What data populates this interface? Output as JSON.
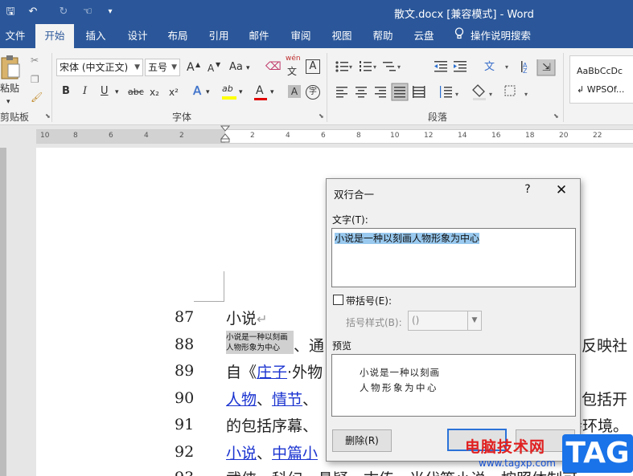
{
  "window": {
    "doc_title": "散文.docx [兼容模式]  -  Word"
  },
  "quick_access": {
    "save_glyph": "🖫",
    "undo_glyph": "↶",
    "redo_glyph": "↻",
    "touch_glyph": "☜",
    "customize_glyph": "▾"
  },
  "tabs": [
    {
      "label": "文件"
    },
    {
      "label": "开始"
    },
    {
      "label": "插入"
    },
    {
      "label": "设计"
    },
    {
      "label": "布局"
    },
    {
      "label": "引用"
    },
    {
      "label": "邮件"
    },
    {
      "label": "审阅"
    },
    {
      "label": "视图"
    },
    {
      "label": "帮助"
    },
    {
      "label": "云盘"
    }
  ],
  "tell_me": {
    "label": "操作说明搜索",
    "icon": "lightbulb-icon"
  },
  "ribbon": {
    "clipboard": {
      "paste_label": "粘贴",
      "group_label": "剪贴板"
    },
    "font": {
      "font_name": "宋体 (中文正文)",
      "font_size": "五号",
      "grow": "A",
      "shrink": "A",
      "case": "Aa",
      "phonetic_top": "wén",
      "phonetic_bottom": "文",
      "border_char": "A",
      "bold": "B",
      "italic": "I",
      "underline": "U",
      "strike": "abc",
      "subscript": "x₂",
      "superscript": "x²",
      "effects": "A",
      "highlight": "ab",
      "font_color": "A",
      "shade_char": "A",
      "enclose": "字",
      "group_label": "字体"
    },
    "paragraph": {
      "group_label": "段落"
    },
    "styles": {
      "style1": "AaBbCcDc",
      "style2": "↲ WPSOf..."
    }
  },
  "ruler": {
    "numbers": [
      "10",
      "8",
      "6",
      "4",
      "2",
      "2",
      "4",
      "6",
      "8",
      "10",
      "12",
      "14",
      "16",
      "18",
      "20",
      "22",
      "24",
      "26",
      "28"
    ]
  },
  "document": {
    "lines": [
      {
        "num": "87"
      },
      {
        "num": "88"
      },
      {
        "num": "89"
      },
      {
        "num": "90"
      },
      {
        "num": "91"
      },
      {
        "num": "92"
      },
      {
        "num": "93"
      }
    ],
    "line87_text": "小说",
    "line87_mark": "↵",
    "combined_top": "小说是一种以刻画",
    "combined_bottom": "人物形象为中心",
    "line88_a": "、通",
    "line88_b": "反映社",
    "line89_a": "自《",
    "line89_link": "庄子",
    "line89_b": "·外物",
    "line90_link1": "人物",
    "line90_sep": "、",
    "line90_link2": "情节",
    "line90_c": "、",
    "line90_d": "包括开",
    "line91_a": "的包括序幕、",
    "line91_b": "会环境。",
    "line92_link1": "小说",
    "line92_sep": "、",
    "line92_link2": "中篇小",
    "line93_a": "武侠、科幻、悬疑、古传、当代等小说。按照体制可"
  },
  "dialog": {
    "title": "双行合一",
    "help": "?",
    "close": "✕",
    "text_label": "文字(T):",
    "text_value": "小说是一种以刻画人物形象为中心",
    "bracket_label": "带括号(E):",
    "bracket_style_label": "括号样式(B):",
    "bracket_style_value": "()",
    "preview_label": "预览",
    "preview_line1": "小说是一种以刻画",
    "preview_line2": "人物形象为中心",
    "delete_label": "删除(R)",
    "ok_label": "",
    "cancel_label": ""
  },
  "watermark": {
    "brand": "电脑技术网",
    "url": "www.tagxp.com",
    "tag": "TAG"
  }
}
